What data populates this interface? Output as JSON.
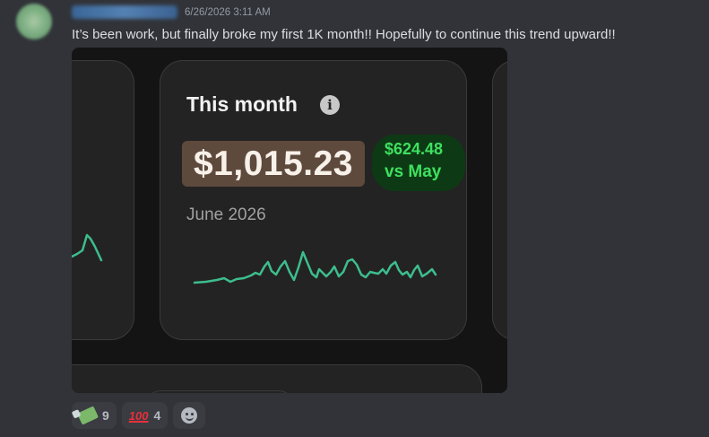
{
  "message": {
    "timestamp": "6/26/2026 3:11 AM",
    "content": "It’s been work, but finally broke my first 1K month!! Hopefully to continue this trend upward!!"
  },
  "card": {
    "title": "This month",
    "info_icon": "info-icon",
    "amount": "$1,015.23",
    "change_value": "$624.48",
    "change_label": "vs May",
    "period": "June 2026",
    "colors": {
      "amount_highlight": "#5e4a3c",
      "change_text": "#3fe060",
      "change_bg": "#0d3a14",
      "sparkline": "#3dbd8d"
    }
  },
  "reactions": [
    {
      "emoji": "money-with-wings",
      "count": "9"
    },
    {
      "emoji": "hundred-points",
      "count": "4"
    }
  ],
  "add_reaction_icon": "smile-icon",
  "colors": {
    "background": "#313338",
    "timestamp": "#949ba4",
    "text": "#dbdee1"
  }
}
